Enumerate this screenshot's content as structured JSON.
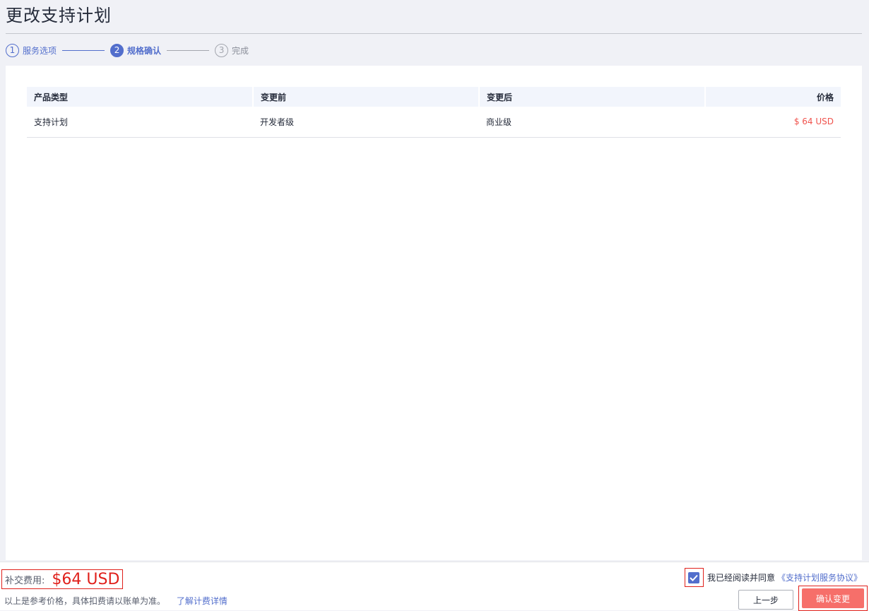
{
  "page": {
    "title": "更改支持计划"
  },
  "steps": [
    {
      "num": "1",
      "label": "服务选项",
      "state": "done"
    },
    {
      "num": "2",
      "label": "规格确认",
      "state": "active"
    },
    {
      "num": "3",
      "label": "完成",
      "state": "pending"
    }
  ],
  "table": {
    "headers": [
      "产品类型",
      "变更前",
      "变更后",
      "价格"
    ],
    "rows": [
      {
        "product_type": "支持计划",
        "before": "开发者级",
        "after": "商业级",
        "price": "$ 64 USD"
      }
    ]
  },
  "footer": {
    "fee_label": "补交费用:",
    "fee_amount": "$64 USD",
    "note": "以上是参考价格，具体扣费请以账单为准。",
    "fee_detail_link": "了解计费详情",
    "agree_text": "我已经阅读并同意",
    "agree_link": "《支持计划服务协议》",
    "agree_checked": true,
    "prev_button": "上一步",
    "confirm_button": "确认变更"
  },
  "colors": {
    "accent": "#526ecc",
    "price_red": "#f0534d",
    "highlight_red": "#e0201b",
    "confirm_bg": "#f66f6a"
  }
}
